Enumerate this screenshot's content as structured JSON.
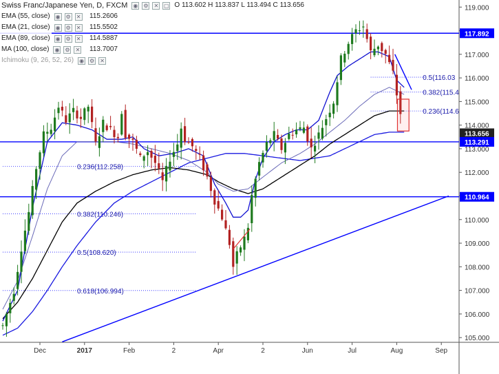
{
  "header": {
    "title": "Swiss Franc/Japanese Yen, D, FXCM",
    "open_label": "O",
    "open": "113.602",
    "high_label": "H",
    "high": "113.837",
    "low_label": "L",
    "low": "113.494",
    "close_label": "C",
    "close": "113.656"
  },
  "indicators": [
    {
      "label": "EMA (55, close)",
      "value": "115.2606"
    },
    {
      "label": "EMA (21, close)",
      "value": "115.5502"
    },
    {
      "label": "EMA (89, close)",
      "value": "114.5887"
    },
    {
      "label": "MA (100, close)",
      "value": "113.7007"
    },
    {
      "label": "Ichimoku (9, 26, 52, 26)",
      "value": ""
    }
  ],
  "icons": [
    "eye-icon",
    "gear-icon",
    "close-icon",
    "expand-icon"
  ],
  "colors": {
    "price_line": "#0000ff",
    "up_candle": "#1e7a1e",
    "down_candle": "#b22222",
    "ema21": "#1010d0",
    "ema55": "#6a6ab8",
    "ema89": "#000000",
    "ma100": "#1818e0",
    "box": "#e03030"
  },
  "chart_data": {
    "type": "candlestick",
    "title": "Swiss Franc/Japanese Yen, D, FXCM",
    "ylim": [
      104.8,
      119.3
    ],
    "y_ticks": [
      "119.000",
      "118.000",
      "117.000",
      "116.000",
      "115.000",
      "114.000",
      "113.000",
      "112.000",
      "111.000",
      "110.000",
      "109.000",
      "108.000",
      "107.000",
      "106.000",
      "105.000"
    ],
    "x_ticks": [
      "Dec",
      "2017",
      "Feb",
      "2",
      "Apr",
      "2",
      "Jun",
      "Jul",
      "Aug",
      "Sep"
    ],
    "x_tick_index": [
      10,
      22,
      34,
      46,
      58,
      70,
      82,
      94,
      106,
      118
    ],
    "n_bars": 108,
    "horizontal_levels": [
      {
        "label": "117.892",
        "value": 117.892
      },
      {
        "label": "113.656",
        "value": 113.656,
        "dark": true
      },
      {
        "label": "113.291",
        "value": 113.291
      },
      {
        "label": "110.964",
        "value": 110.964
      }
    ],
    "trendline": {
      "from": [
        16,
        104.82
      ],
      "to": [
        120,
        111.0
      ]
    },
    "fib_levels": [
      {
        "label": "0.236(112.258)",
        "value": 112.258,
        "x_from": 0,
        "x_to": 52,
        "text_x": 20
      },
      {
        "label": "0.382(110.246)",
        "value": 110.246,
        "x_from": 0,
        "x_to": 52,
        "text_x": 20
      },
      {
        "label": "0.5(108.620)",
        "value": 108.62,
        "x_from": 0,
        "x_to": 52,
        "text_x": 20
      },
      {
        "label": "0.618(106.994)",
        "value": 106.994,
        "x_from": 0,
        "x_to": 52,
        "text_x": 20
      },
      {
        "label": "0.5(116.03",
        "value": 116.03,
        "x_from": 99,
        "x_to": 114,
        "text_x": 113
      },
      {
        "label": "0.382(115.4",
        "value": 115.4,
        "x_from": 99,
        "x_to": 114,
        "text_x": 113
      },
      {
        "label": "0.236(114.6",
        "value": 114.6,
        "x_from": 99,
        "x_to": 114,
        "text_x": 113
      }
    ],
    "box": {
      "x_from": 106.2,
      "x_to": 109.3,
      "y_from": 113.75,
      "y_to": 115.1
    },
    "small_trendline": {
      "from": [
        62,
        108.75
      ],
      "to": [
        66.5,
        109.6
      ]
    },
    "projection_line": {
      "from": [
        105.5,
        117.0
      ],
      "to": [
        110,
        115.5
      ]
    },
    "price_anchors": [
      [
        0,
        105.5
      ],
      [
        3,
        107.0
      ],
      [
        5,
        108.8
      ],
      [
        7,
        110.3
      ],
      [
        9,
        112.2
      ],
      [
        11,
        113.6
      ],
      [
        13,
        113.9
      ],
      [
        15,
        114.8
      ],
      [
        17,
        114.2
      ],
      [
        19,
        114.6
      ],
      [
        21,
        114.3
      ],
      [
        23,
        114.8
      ],
      [
        25,
        113.2
      ],
      [
        27,
        114.1
      ],
      [
        29,
        113.8
      ],
      [
        31,
        113.5
      ],
      [
        32,
        114.6
      ],
      [
        33,
        113.6
      ],
      [
        35,
        113.3
      ],
      [
        37,
        112.6
      ],
      [
        39,
        112.9
      ],
      [
        41,
        112.4
      ],
      [
        43,
        111.6
      ],
      [
        45,
        112.6
      ],
      [
        47,
        113.2
      ],
      [
        48,
        113.9
      ],
      [
        49,
        113.4
      ],
      [
        51,
        113.1
      ],
      [
        53,
        112.6
      ],
      [
        55,
        111.8
      ],
      [
        57,
        110.8
      ],
      [
        59,
        110.1
      ],
      [
        61,
        109.0
      ],
      [
        62,
        108.0
      ],
      [
        63,
        108.5
      ],
      [
        65,
        109.2
      ],
      [
        66,
        109.7
      ],
      [
        67,
        111.0
      ],
      [
        69,
        112.4
      ],
      [
        71,
        113.2
      ],
      [
        73,
        113.6
      ],
      [
        75,
        113.0
      ],
      [
        77,
        113.6
      ],
      [
        79,
        113.8
      ],
      [
        81,
        113.9
      ],
      [
        83,
        113.0
      ],
      [
        85,
        113.6
      ],
      [
        87,
        114.3
      ],
      [
        89,
        115.0
      ],
      [
        91,
        116.8
      ],
      [
        93,
        117.5
      ],
      [
        95,
        118.0
      ],
      [
        97,
        118.2
      ],
      [
        99,
        117.1
      ],
      [
        101,
        117.4
      ],
      [
        103,
        117.0
      ],
      [
        105,
        116.2
      ],
      [
        106,
        115.3
      ],
      [
        107,
        114.5
      ],
      [
        108,
        113.7
      ],
      [
        109,
        113.65
      ]
    ],
    "ema21_anchors": [
      [
        0,
        105.7
      ],
      [
        4,
        107.0
      ],
      [
        8,
        110.5
      ],
      [
        12,
        113.3
      ],
      [
        16,
        114.1
      ],
      [
        20,
        114.0
      ],
      [
        24,
        113.8
      ],
      [
        28,
        113.4
      ],
      [
        32,
        113.4
      ],
      [
        35,
        113.5
      ],
      [
        38,
        113.0
      ],
      [
        42,
        112.7
      ],
      [
        46,
        112.8
      ],
      [
        50,
        113.0
      ],
      [
        54,
        112.7
      ],
      [
        57,
        111.5
      ],
      [
        60,
        110.7
      ],
      [
        62,
        110.1
      ],
      [
        64,
        110.1
      ],
      [
        66,
        110.4
      ],
      [
        68,
        111.7
      ],
      [
        70,
        112.6
      ],
      [
        73,
        113.3
      ],
      [
        76,
        113.6
      ],
      [
        79,
        113.8
      ],
      [
        82,
        113.8
      ],
      [
        85,
        114.2
      ],
      [
        88,
        115.4
      ],
      [
        90,
        116.1
      ],
      [
        93,
        116.5
      ],
      [
        96,
        116.8
      ],
      [
        99,
        117.1
      ],
      [
        101,
        117.1
      ],
      [
        104,
        116.9
      ],
      [
        106,
        115.9
      ],
      [
        108,
        115.6
      ]
    ],
    "ema55_anchors": [
      [
        0,
        106.2
      ],
      [
        4,
        107.4
      ],
      [
        8,
        109.3
      ],
      [
        12,
        111.3
      ],
      [
        16,
        112.7
      ],
      [
        20,
        113.3
      ],
      [
        25,
        113.3
      ],
      [
        30,
        113.3
      ],
      [
        35,
        113.2
      ],
      [
        40,
        113.0
      ],
      [
        45,
        112.8
      ],
      [
        50,
        112.5
      ],
      [
        55,
        112.0
      ],
      [
        58,
        111.5
      ],
      [
        62,
        111.2
      ],
      [
        66,
        111.3
      ],
      [
        70,
        111.8
      ],
      [
        75,
        112.4
      ],
      [
        80,
        112.8
      ],
      [
        84,
        113.2
      ],
      [
        88,
        113.7
      ],
      [
        92,
        114.2
      ],
      [
        96,
        114.8
      ],
      [
        100,
        115.3
      ],
      [
        104,
        115.6
      ],
      [
        108,
        115.3
      ]
    ],
    "ema89_anchors": [
      [
        0,
        105.8
      ],
      [
        4,
        106.5
      ],
      [
        8,
        107.5
      ],
      [
        12,
        108.7
      ],
      [
        16,
        109.9
      ],
      [
        20,
        110.7
      ],
      [
        25,
        111.2
      ],
      [
        30,
        111.6
      ],
      [
        35,
        111.9
      ],
      [
        40,
        112.1
      ],
      [
        45,
        112.2
      ],
      [
        50,
        112.1
      ],
      [
        55,
        111.9
      ],
      [
        58,
        111.6
      ],
      [
        62,
        111.3
      ],
      [
        66,
        111.1
      ],
      [
        70,
        111.3
      ],
      [
        75,
        111.8
      ],
      [
        80,
        112.3
      ],
      [
        84,
        112.7
      ],
      [
        88,
        113.2
      ],
      [
        92,
        113.6
      ],
      [
        96,
        114.0
      ],
      [
        100,
        114.4
      ],
      [
        104,
        114.6
      ],
      [
        108,
        114.6
      ]
    ],
    "ma100_anchors": [
      [
        0,
        105.1
      ],
      [
        4,
        105.4
      ],
      [
        8,
        106.1
      ],
      [
        12,
        107.0
      ],
      [
        16,
        108.0
      ],
      [
        20,
        108.9
      ],
      [
        25,
        109.9
      ],
      [
        30,
        110.7
      ],
      [
        35,
        111.2
      ],
      [
        40,
        111.6
      ],
      [
        45,
        112.0
      ],
      [
        50,
        112.4
      ],
      [
        55,
        112.6
      ],
      [
        60,
        112.8
      ],
      [
        65,
        112.8
      ],
      [
        70,
        112.7
      ],
      [
        75,
        112.6
      ],
      [
        80,
        112.5
      ],
      [
        84,
        112.6
      ],
      [
        88,
        112.7
      ],
      [
        92,
        113.0
      ],
      [
        96,
        113.3
      ],
      [
        100,
        113.6
      ],
      [
        104,
        113.7
      ],
      [
        108,
        113.7
      ]
    ]
  }
}
